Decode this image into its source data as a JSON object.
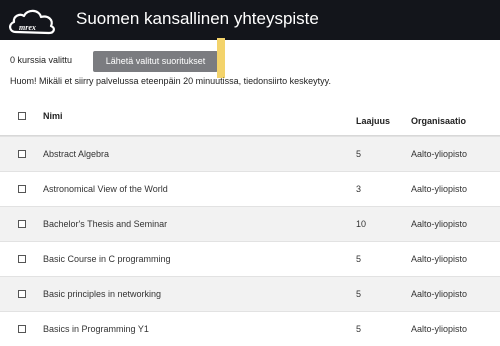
{
  "header": {
    "logo_text": "mrex",
    "title": "Suomen kansallinen yhteyspiste"
  },
  "toolbar": {
    "selected_count": "0 kurssia valittu",
    "send_button": "Lähetä valitut suoritukset"
  },
  "notice": "Huom! Mikäli et siirry palvelussa eteenpäin 20 minuutissa, tiedonsiirto keskeytyy.",
  "table": {
    "columns": {
      "name": "Nimi",
      "credits": "Laajuus",
      "organization": "Organisaatio"
    },
    "rows": [
      {
        "name": "Abstract Algebra",
        "credits": "5",
        "organization": "Aalto-yliopisto"
      },
      {
        "name": "Astronomical View of the World",
        "credits": "3",
        "organization": "Aalto-yliopisto"
      },
      {
        "name": "Bachelor's Thesis and Seminar",
        "credits": "10",
        "organization": "Aalto-yliopisto"
      },
      {
        "name": "Basic Course in C programming",
        "credits": "5",
        "organization": "Aalto-yliopisto"
      },
      {
        "name": "Basic principles in networking",
        "credits": "5",
        "organization": "Aalto-yliopisto"
      },
      {
        "name": "Basics in Programming Y1",
        "credits": "5",
        "organization": "Aalto-yliopisto"
      }
    ]
  },
  "colors": {
    "header_bg": "#13151b",
    "button_bg": "#7b7c80",
    "highlight": "#f3d36b",
    "row_stripe": "#f2f2f2"
  }
}
